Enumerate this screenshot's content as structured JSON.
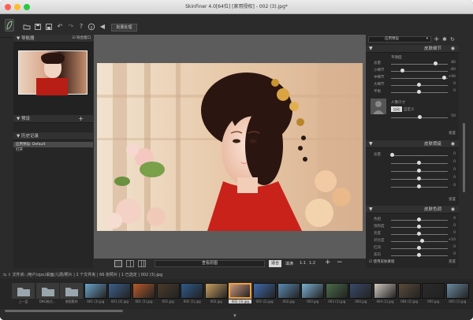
{
  "window": {
    "title": "SkinFiner 4.0[64位] [家用授权] - 002 (3).jpg*"
  },
  "toolbar": {
    "batch_label": "批量处理",
    "icons": [
      "logo-leaf-icon",
      "folder-open-icon",
      "save-icon",
      "save-as-icon",
      "undo-icon",
      "redo-icon",
      "help-icon",
      "info-icon",
      "share-icon"
    ]
  },
  "left": {
    "navigator": {
      "title": "导航器",
      "fit_label": "符合窗口",
      "fit_checked": true
    },
    "preset": {
      "title": "预设",
      "add_symbol": "+"
    },
    "history": {
      "title": "历史记录",
      "items": [
        "应用预设: Default",
        "打开"
      ],
      "selected_index": 0
    }
  },
  "bottom": {
    "view_original": "查看原图",
    "fit": "适合",
    "fill": "填满",
    "zoom_ratio": "1:1",
    "zoom_ratio2": "1:2",
    "plus": "+",
    "minus": "−"
  },
  "right": {
    "preset_dropdown": "应用预设",
    "add": "+",
    "skin_detail": {
      "title": "皮肤细节",
      "section_label": "平滑度",
      "sliders": [
        {
          "label": "总量",
          "value": "80",
          "pos": 0.8
        },
        {
          "label": "小细节",
          "value": "-80",
          "pos": 0.2
        },
        {
          "label": "中细节",
          "value": "+90",
          "pos": 0.95
        },
        {
          "label": "大细节",
          "value": "0",
          "pos": 0.5
        },
        {
          "label": "平衡",
          "value": "0",
          "pos": 0.5
        }
      ],
      "face_label": "人像只寸",
      "face_btn1": "自动",
      "face_btn2": "自定义",
      "face_value": "50",
      "reset": "重置"
    },
    "skin_spots": {
      "title": "皮肤瑕疵",
      "sliders": [
        {
          "label": "总量",
          "value": "0",
          "pos": 0.02
        },
        {
          "label": "",
          "value": "0",
          "pos": 0.5
        },
        {
          "label": "",
          "value": "0",
          "pos": 0.5
        },
        {
          "label": "",
          "value": "0",
          "pos": 0.5
        },
        {
          "label": "",
          "value": "0",
          "pos": 0.5
        }
      ],
      "reset": "重置"
    },
    "skin_color": {
      "title": "皮肤色调",
      "sliders": [
        {
          "label": "色相",
          "value": "0",
          "pos": 0.5
        },
        {
          "label": "饱和度",
          "value": "0",
          "pos": 0.5
        },
        {
          "label": "亮度",
          "value": "0",
          "pos": 0.5
        },
        {
          "label": "对比度",
          "value": "+10",
          "pos": 0.55
        },
        {
          "label": "红润",
          "value": "0",
          "pos": 0.5
        },
        {
          "label": "美白",
          "value": "0",
          "pos": 0.5
        }
      ],
      "check_label": "使用皮肤蒙版",
      "reset": "重置"
    }
  },
  "filmstrip": {
    "path": "文件夹: /用户/zjzc/桌面/儿把/照片 | 2 个文件夹 | 66 张照片 | 1 已选定 | 002 (3).jpg",
    "thumbs": [
      {
        "label": "上一层",
        "type": "folder"
      },
      {
        "label": "DNG格式...",
        "type": "folder"
      },
      {
        "label": "原图素材",
        "type": "folder"
      },
      {
        "label": "001 (3).jpg",
        "type": "img",
        "color": "#6aa3c8"
      },
      {
        "label": "001 (2).jpg",
        "type": "img",
        "color": "#3c5f8a"
      },
      {
        "label": "001 (1).jpg",
        "type": "img",
        "color": "#b85a2a"
      },
      {
        "label": "001.jpg",
        "type": "img",
        "color": "#4a3a2a"
      },
      {
        "label": "002 (1).jpg",
        "type": "img",
        "color": "#2e5a8a"
      },
      {
        "label": "002.jpg",
        "type": "img",
        "color": "#c8a060"
      },
      {
        "label": "002 (3).jpg",
        "type": "img",
        "color": "#c9967a"
      },
      {
        "label": "002 (2).jpg",
        "type": "img",
        "color": "#3e6aa8"
      },
      {
        "label": "002.jpg",
        "type": "img",
        "color": "#5a8ab0"
      },
      {
        "label": "003.jpg",
        "type": "img",
        "color": "#7ab0d0"
      },
      {
        "label": "003 (1).jpg",
        "type": "img",
        "color": "#4a6a4a"
      },
      {
        "label": "004.jpg",
        "type": "img",
        "color": "#3a4a6a"
      },
      {
        "label": "004 (1).jpg",
        "type": "img",
        "color": "#d0c8c0"
      },
      {
        "label": "004 (2).jpg",
        "type": "img",
        "color": "#5a4a3a"
      },
      {
        "label": "005.jpg",
        "type": "img",
        "color": "#2a2a2a"
      },
      {
        "label": "005 (1).jpg",
        "type": "img",
        "color": "#6a8aa0"
      }
    ],
    "selected_index": 9
  }
}
